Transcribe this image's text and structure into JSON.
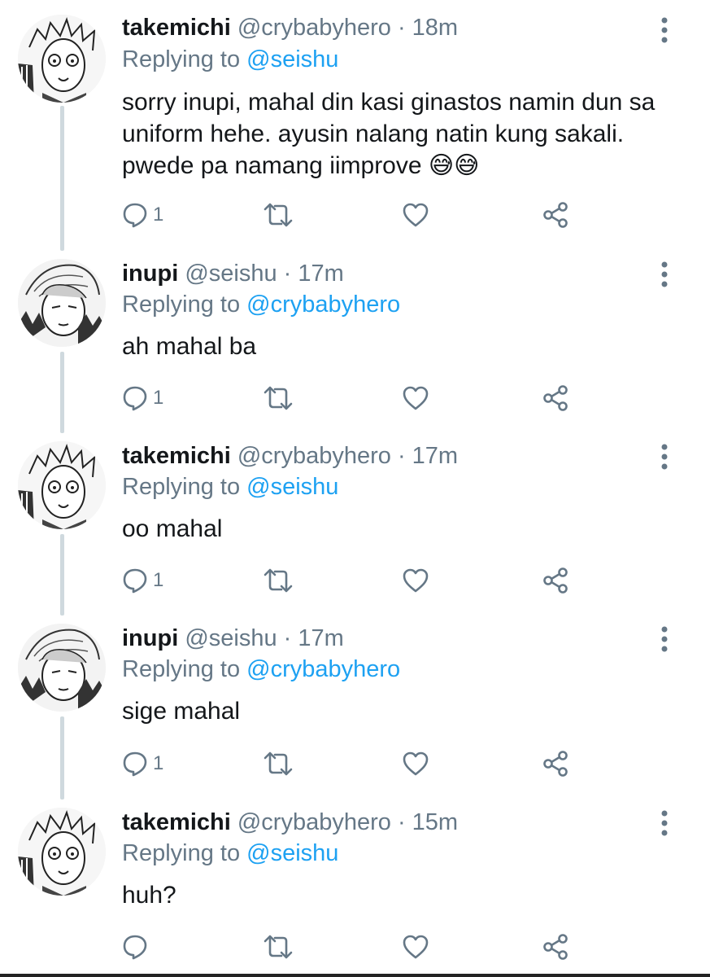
{
  "tweets": [
    {
      "name": "takemichi",
      "handle": "@crybabyhero",
      "time": "· 18m",
      "replying_prefix": "Replying to",
      "replying_to": "@seishu",
      "text": "sorry inupi, mahal din kasi ginastos namin dun sa uniform hehe. ayusin nalang natin kung sakali. pwede pa namang iimprove 😅😅",
      "reply_count": "1",
      "avatar": "takemichi"
    },
    {
      "name": "inupi",
      "handle": "@seishu",
      "time": "· 17m",
      "replying_prefix": "Replying to",
      "replying_to": "@crybabyhero",
      "text": "ah mahal ba",
      "reply_count": "1",
      "avatar": "inupi"
    },
    {
      "name": "takemichi",
      "handle": "@crybabyhero",
      "time": "· 17m",
      "replying_prefix": "Replying to",
      "replying_to": "@seishu",
      "text": "oo mahal",
      "reply_count": "1",
      "avatar": "takemichi"
    },
    {
      "name": "inupi",
      "handle": "@seishu",
      "time": "· 17m",
      "replying_prefix": "Replying to",
      "replying_to": "@crybabyhero",
      "text": "sige mahal",
      "reply_count": "1",
      "avatar": "inupi"
    },
    {
      "name": "takemichi",
      "handle": "@crybabyhero",
      "time": "· 15m",
      "replying_prefix": "Replying to",
      "replying_to": "@seishu",
      "text": "huh?",
      "reply_count": "",
      "avatar": "takemichi"
    }
  ],
  "icons": {
    "reply": "reply-icon",
    "retweet": "retweet-icon",
    "like": "heart-icon",
    "share": "share-icon",
    "more": "more-vertical-icon"
  },
  "colors": {
    "mention": "#1da1f2",
    "secondary_text": "#657786",
    "primary_text": "#14171a",
    "thread_line": "#cfd9de"
  }
}
